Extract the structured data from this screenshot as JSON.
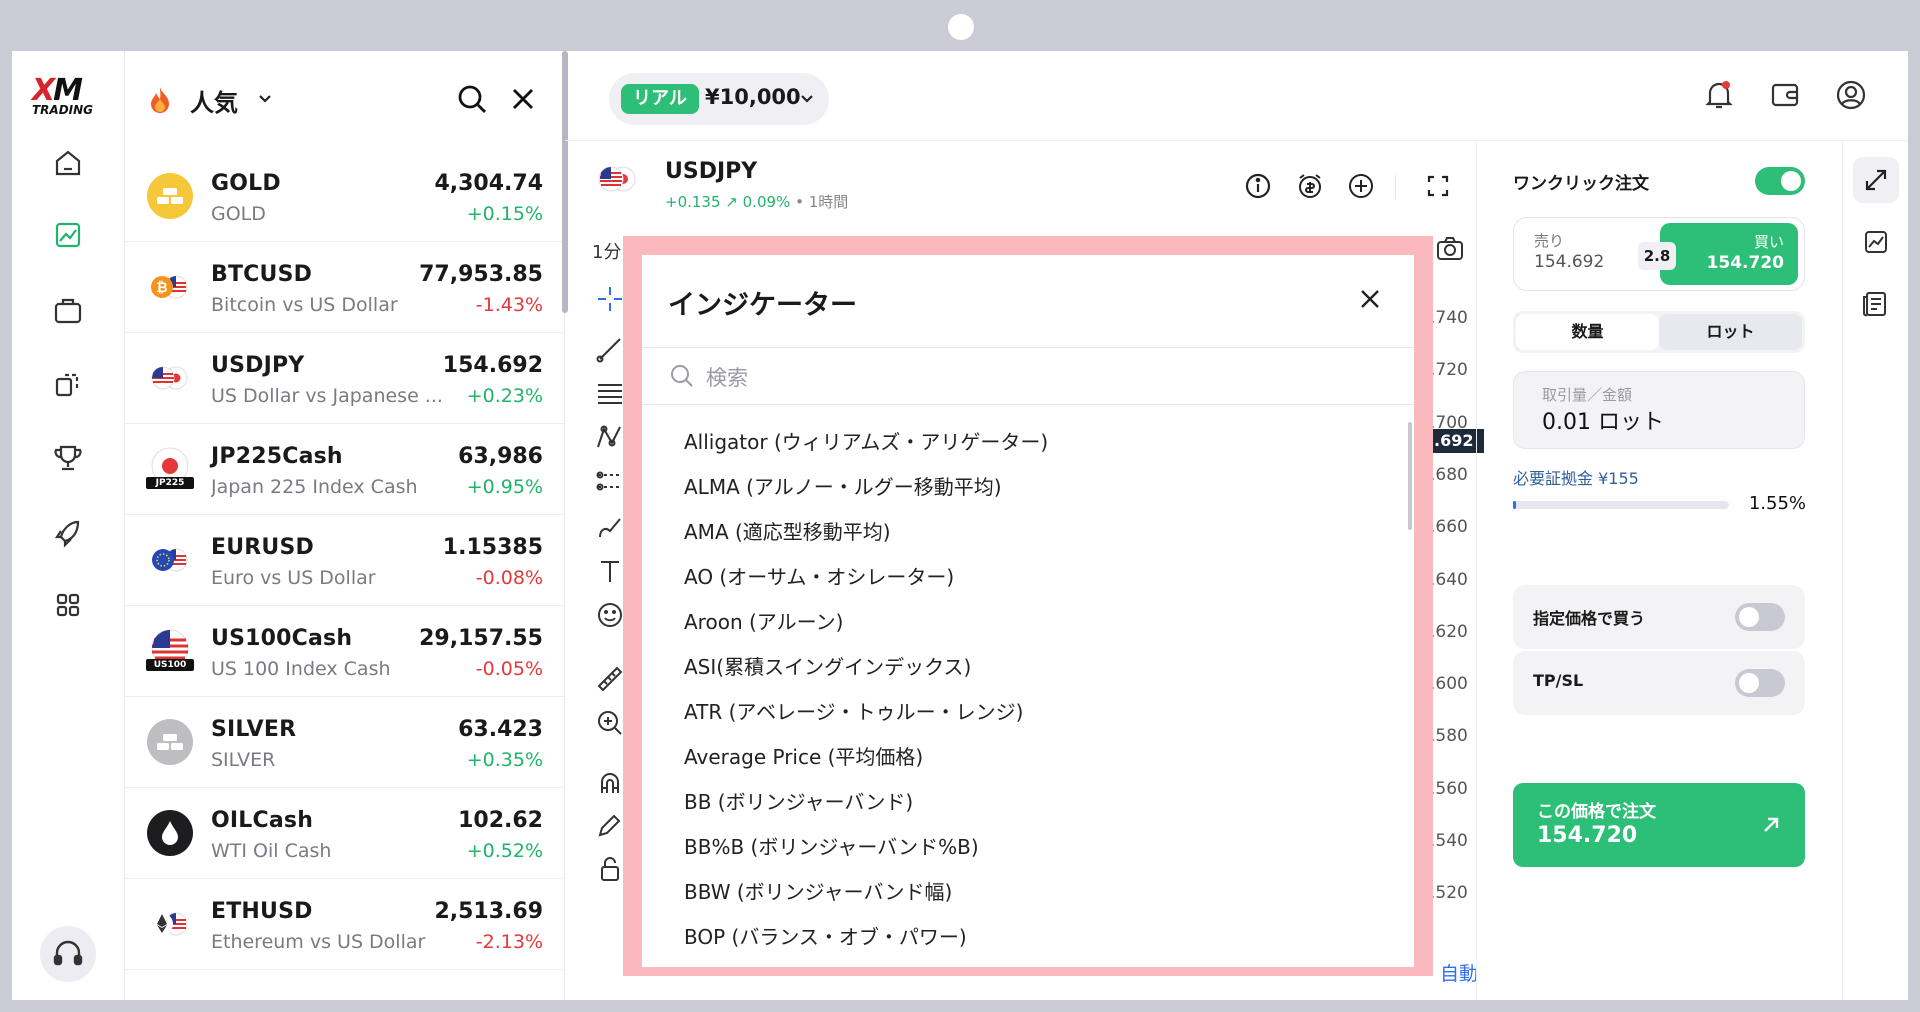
{
  "brand": {
    "logo_top": "XM",
    "logo_bottom": "TRADING"
  },
  "market_list": {
    "header": {
      "title": "人気"
    },
    "rows": [
      {
        "symbol": "GOLD",
        "desc": "GOLD",
        "price": "4,304.74",
        "change": "+0.15%",
        "dir": "up",
        "icon": "gold-bar-icon"
      },
      {
        "symbol": "BTCUSD",
        "desc": "Bitcoin vs US Dollar",
        "price": "77,953.85",
        "change": "-1.43%",
        "dir": "down",
        "icon": "bitcoin-us-flag-icon"
      },
      {
        "symbol": "USDJPY",
        "desc": "US Dollar vs Japanese ...",
        "price": "154.692",
        "change": "+0.23%",
        "dir": "up",
        "icon": "us-japan-flag-icon"
      },
      {
        "symbol": "JP225Cash",
        "desc": "Japan 225 Index Cash",
        "price": "63,986",
        "change": "+0.95%",
        "dir": "up",
        "icon": "japan-flag-icon",
        "badge": "JP225"
      },
      {
        "symbol": "EURUSD",
        "desc": "Euro vs US Dollar",
        "price": "1.15385",
        "change": "-0.08%",
        "dir": "down",
        "icon": "eu-us-flag-icon"
      },
      {
        "symbol": "US100Cash",
        "desc": "US 100 Index Cash",
        "price": "29,157.55",
        "change": "-0.05%",
        "dir": "down",
        "icon": "us-flag-icon",
        "badge": "US100"
      },
      {
        "symbol": "SILVER",
        "desc": "SILVER",
        "price": "63.423",
        "change": "+0.35%",
        "dir": "up",
        "icon": "silver-bar-icon"
      },
      {
        "symbol": "OILCash",
        "desc": "WTI Oil Cash",
        "price": "102.62",
        "change": "+0.52%",
        "dir": "up",
        "icon": "oil-drop-icon"
      },
      {
        "symbol": "ETHUSD",
        "desc": "Ethereum vs US Dollar",
        "price": "2,513.69",
        "change": "-2.13%",
        "dir": "down",
        "icon": "ethereum-us-flag-icon"
      }
    ]
  },
  "account": {
    "type": "リアル",
    "balance": "¥10,000"
  },
  "chart": {
    "symbol": "USDJPY",
    "change_abs": "+0.135",
    "change_pct": "↗ 0.09%",
    "timeframe_label": "• 1時間",
    "timeframe_toolbar": "1分",
    "axis_labels": [
      ".740",
      ".720",
      ".700",
      ".680",
      ".660",
      ".640",
      ".620",
      ".600",
      ".580",
      ".560",
      ".540",
      ".520"
    ],
    "current_price_tag": ".692",
    "auto_label": "自動"
  },
  "indicator_modal": {
    "title": "インジケーター",
    "search_placeholder": "検索",
    "items": [
      "Alligator (ウィリアムズ・アリゲーター)",
      "ALMA (アルノー・ルグー移動平均)",
      "AMA (適応型移動平均)",
      "AO (オーサム・オシレーター)",
      "Aroon (アルーン)",
      "ASI(累積スイングインデックス)",
      "ATR (アベレージ・トゥルー・レンジ)",
      "Average Price (平均価格)",
      "BB (ボリンジャーバンド)",
      "BB%B (ボリンジャーバンド%B)",
      "BBW (ボリンジャーバンド幅)",
      "BOP (バランス・オブ・パワー)"
    ]
  },
  "order_panel": {
    "one_click_label": "ワンクリック注文",
    "one_click_on": true,
    "sell_label": "売り",
    "sell_price": "154.692",
    "spread": "2.8",
    "buy_label": "買い",
    "buy_price": "154.720",
    "tab_quantity": "数量",
    "tab_lot": "ロット",
    "volume_label": "取引量／金額",
    "volume_value": "0.01 ロット",
    "margin_label": "必要証拠金 ¥155",
    "margin_pct": "1.55%",
    "margin_fraction": 0.0155,
    "limit_label": "指定価格で買う",
    "limit_on": false,
    "tpsl_label": "TP/SL",
    "tpsl_on": false,
    "order_btn_label": "この価格で注文",
    "order_btn_price": "154.720"
  },
  "colors": {
    "accent_green": "#2dbe77",
    "negative_red": "#e5383b",
    "overlay_pink": "#fcb9bd",
    "link_blue": "#2d6ff0"
  }
}
